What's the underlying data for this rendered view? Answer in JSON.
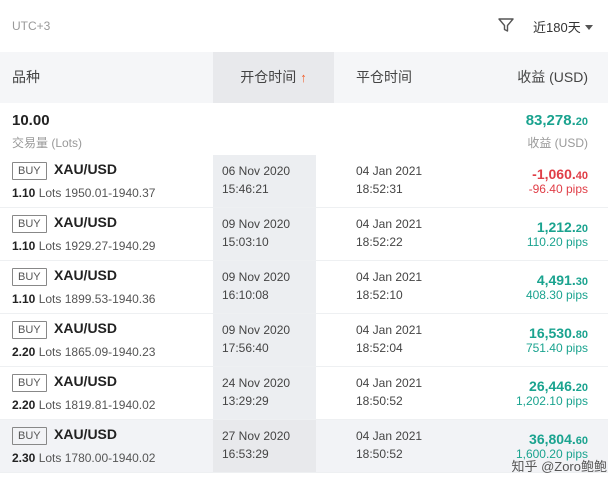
{
  "header": {
    "timezone": "UTC+3",
    "range_label": "近180天",
    "icons": [
      "filter-icon",
      "caret-down-icon",
      "sort-up-arrow-icon"
    ]
  },
  "columns": {
    "product": "品种",
    "open_time": "开仓时间",
    "sort_arrow": "↑",
    "close_time": "平仓时间",
    "profit": "收益 (USD)"
  },
  "summary": {
    "volume": "10.00",
    "volume_label": "交易量 (Lots)",
    "profit_int": "83,278.",
    "profit_dec": "20",
    "profit_label": "收益 (USD)"
  },
  "trades": [
    {
      "side": "BUY",
      "symbol": "XAU/USD",
      "lots": "1.10",
      "lots_unit": "Lots",
      "price_range": "1950.01-1940.37",
      "open_date": "06 Nov 2020",
      "open_time": "15:46:21",
      "close_date": "04 Jan 2021",
      "close_time": "18:52:31",
      "profit_int": "-1,060.",
      "profit_dec": "40",
      "pips": "-96.40 pips",
      "positive": false
    },
    {
      "side": "BUY",
      "symbol": "XAU/USD",
      "lots": "1.10",
      "lots_unit": "Lots",
      "price_range": "1929.27-1940.29",
      "open_date": "09 Nov 2020",
      "open_time": "15:03:10",
      "close_date": "04 Jan 2021",
      "close_time": "18:52:22",
      "profit_int": "1,212.",
      "profit_dec": "20",
      "pips": "110.20 pips",
      "positive": true
    },
    {
      "side": "BUY",
      "symbol": "XAU/USD",
      "lots": "1.10",
      "lots_unit": "Lots",
      "price_range": "1899.53-1940.36",
      "open_date": "09 Nov 2020",
      "open_time": "16:10:08",
      "close_date": "04 Jan 2021",
      "close_time": "18:52:10",
      "profit_int": "4,491.",
      "profit_dec": "30",
      "pips": "408.30 pips",
      "positive": true
    },
    {
      "side": "BUY",
      "symbol": "XAU/USD",
      "lots": "2.20",
      "lots_unit": "Lots",
      "price_range": "1865.09-1940.23",
      "open_date": "09 Nov 2020",
      "open_time": "17:56:40",
      "close_date": "04 Jan 2021",
      "close_time": "18:52:04",
      "profit_int": "16,530.",
      "profit_dec": "80",
      "pips": "751.40 pips",
      "positive": true
    },
    {
      "side": "BUY",
      "symbol": "XAU/USD",
      "lots": "2.20",
      "lots_unit": "Lots",
      "price_range": "1819.81-1940.02",
      "open_date": "24 Nov 2020",
      "open_time": "13:29:29",
      "close_date": "04 Jan 2021",
      "close_time": "18:50:52",
      "profit_int": "26,446.",
      "profit_dec": "20",
      "pips": "1,202.10 pips",
      "positive": true
    },
    {
      "side": "BUY",
      "symbol": "XAU/USD",
      "lots": "2.30",
      "lots_unit": "Lots",
      "price_range": "1780.00-1940.02",
      "open_date": "27 Nov 2020",
      "open_time": "16:53:29",
      "close_date": "04 Jan 2021",
      "close_time": "18:50:52",
      "profit_int": "36,804.",
      "profit_dec": "60",
      "pips": "1,600.20 pips",
      "positive": true
    }
  ],
  "watermark": "知乎 @Zoro鲍鲍",
  "colors": {
    "positive": "#1aa38f",
    "negative": "#e03e47",
    "sort_accent": "#f0612f"
  }
}
